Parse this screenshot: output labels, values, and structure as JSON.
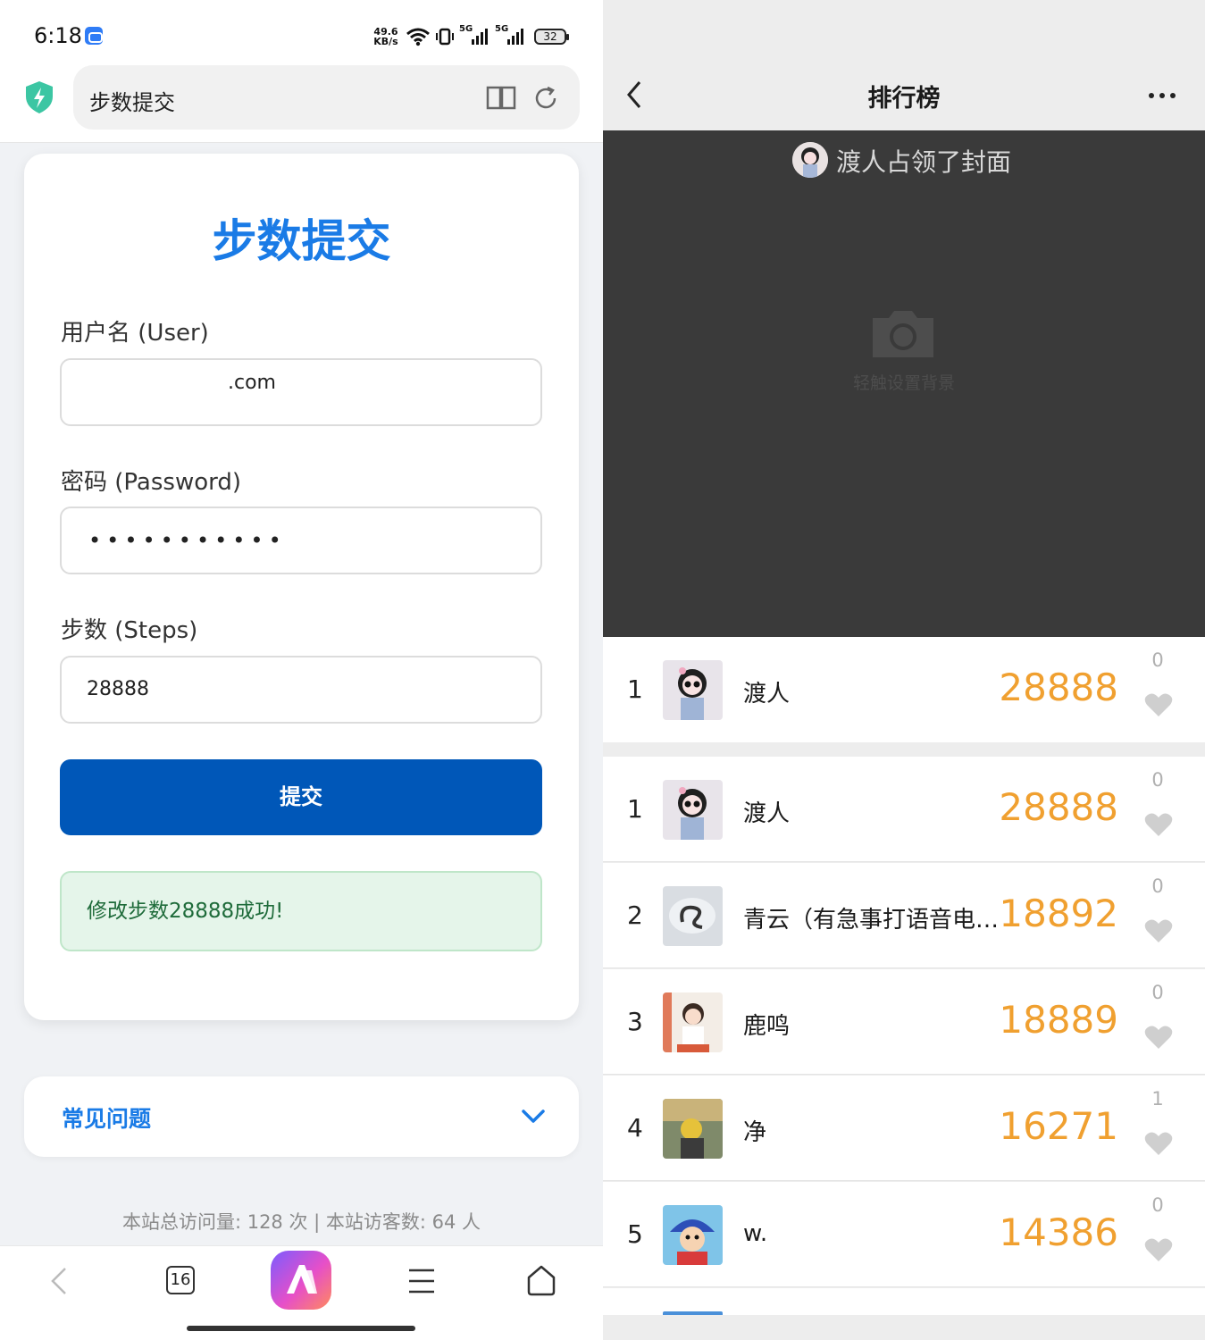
{
  "left": {
    "status": {
      "time": "6:18",
      "speed_top": "49.6",
      "speed_bottom": "KB/s",
      "signal1": "5G",
      "signal2": "5G",
      "battery": "32"
    },
    "urlbar": {
      "title": "步数提交"
    },
    "form": {
      "heading": "步数提交",
      "user_label": "用户名 (User)",
      "user_value": ".com",
      "password_label": "密码 (Password)",
      "password_value": "•••••••••••",
      "steps_label": "步数 (Steps)",
      "steps_value": "28888",
      "submit_label": "提交",
      "success_message": "修改步数28888成功!"
    },
    "faq": {
      "title": "常见问题"
    },
    "footer": {
      "visits": "本站总访问量: 128 次 | 本站访客数: 64 人"
    },
    "nav": {
      "tab_count": "16"
    }
  },
  "right": {
    "header": {
      "title": "排行榜"
    },
    "cover": {
      "text": "渡人占领了封面",
      "hint": "轻触设置背景"
    },
    "colors": {
      "steps": "#f0a030",
      "cover_bg": "#3a3a3a"
    },
    "me": {
      "rank": "1",
      "name": "渡人",
      "steps": "28888",
      "likes": "0"
    },
    "ranking": [
      {
        "rank": "1",
        "name": "渡人",
        "steps": "28888",
        "likes": "0"
      },
      {
        "rank": "2",
        "name": "青云（有急事打语音电…",
        "steps": "18892",
        "likes": "0"
      },
      {
        "rank": "3",
        "name": "鹿鸣",
        "steps": "18889",
        "likes": "0"
      },
      {
        "rank": "4",
        "name": "净",
        "steps": "16271",
        "likes": "1"
      },
      {
        "rank": "5",
        "name": "w.",
        "steps": "14386",
        "likes": "0"
      }
    ]
  }
}
